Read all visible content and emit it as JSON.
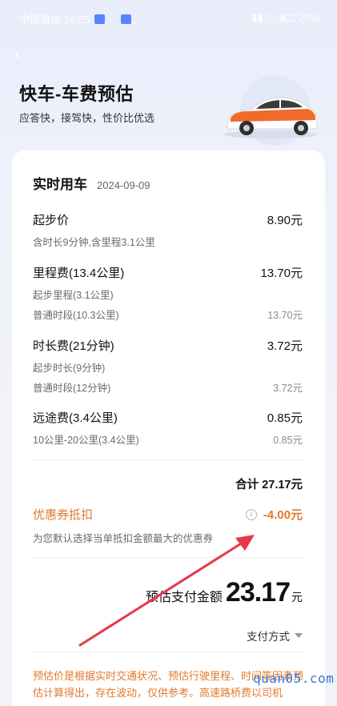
{
  "status_bar": {
    "carrier_time": "中国电信 16:25",
    "battery": "27%"
  },
  "header": {
    "title": "快车-车费预估",
    "subtitle": "应答快，接驾快，性价比优选"
  },
  "card": {
    "title": "实时用车",
    "date": "2024-09-09"
  },
  "fees": {
    "base": {
      "name": "起步价",
      "amount": "8.90元",
      "desc": "含时长9分钟,含里程3.1公里"
    },
    "mileage": {
      "name": "里程费(13.4公里)",
      "amount": "13.70元",
      "sub1": "起步里程(3.1公里)",
      "sub2": "普通时段(10.3公里)",
      "sub2_amount": "13.70元"
    },
    "time": {
      "name": "时长费(21分钟)",
      "amount": "3.72元",
      "sub1": "起步时长(9分钟)",
      "sub2": "普通时段(12分钟)",
      "sub2_amount": "3.72元"
    },
    "long_distance": {
      "name": "远途费(3.4公里)",
      "amount": "0.85元",
      "sub1": "10公里-20公里(3.4公里)",
      "sub1_amount": "0.85元"
    }
  },
  "total": "合计 27.17元",
  "coupon": {
    "name": "优惠券抵扣",
    "amount": "-4.00元",
    "desc": "为您默认选择当单抵扣金额最大的优惠券",
    "info_icon": "i"
  },
  "estimate": {
    "label": "预估支付金额",
    "value": "23.17",
    "unit": "元"
  },
  "payment": {
    "label": "支付方式"
  },
  "note": "预估价是根据实时交通状况、预估行驶里程、时间等因素预估计算得出，存在波动，仅供参考。高速路桥费以司机",
  "watermark": "quan05.com",
  "colors": {
    "accent_orange": "#e07a2e",
    "annotation_red": "#e8374a"
  }
}
